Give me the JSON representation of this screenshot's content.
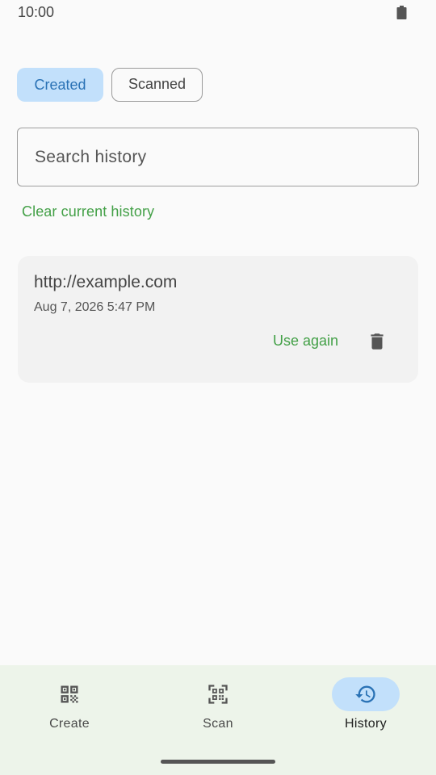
{
  "status_bar": {
    "time": "10:00",
    "battery_icon": "battery-icon"
  },
  "filter_chips": [
    {
      "label": "Created",
      "selected": true
    },
    {
      "label": "Scanned",
      "selected": false
    }
  ],
  "search": {
    "placeholder": "Search history",
    "value": ""
  },
  "clear_history_label": "Clear current history",
  "history_items": [
    {
      "content": "http://example.com",
      "date": "Aug 7, 2026 5:47 PM",
      "use_again_label": "Use again",
      "delete_icon": "trash-icon"
    }
  ],
  "bottom_nav": {
    "items": [
      {
        "label": "Create",
        "icon": "qr-code-icon",
        "active": false
      },
      {
        "label": "Scan",
        "icon": "qr-scan-icon",
        "active": false
      },
      {
        "label": "History",
        "icon": "history-icon",
        "active": true
      }
    ]
  },
  "colors": {
    "accent_green": "#43a047",
    "selected_chip_bg": "#c2e0fb",
    "selected_chip_text": "#2a72b5",
    "nav_bg": "#edf4ea",
    "history_icon": "#2a72b5"
  }
}
